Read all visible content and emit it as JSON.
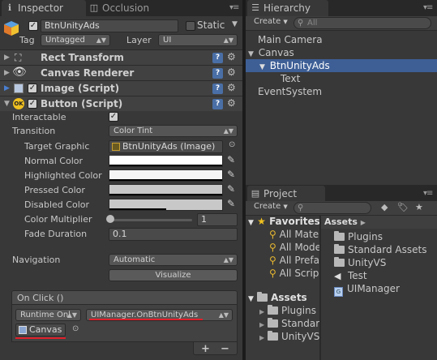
{
  "inspector": {
    "tabs": [
      {
        "label": "Inspector",
        "icon": "info-icon"
      },
      {
        "label": "Occlusion",
        "icon": "occlusion-icon"
      }
    ],
    "object": {
      "name": "BtnUnityAds",
      "active": true,
      "static_label": "Static",
      "tag_label": "Tag",
      "tag_value": "Untagged",
      "layer_label": "Layer",
      "layer_value": "UI"
    },
    "components": [
      {
        "title": "Rect Transform",
        "icon": "rect-transform-icon"
      },
      {
        "title": "Canvas Renderer",
        "icon": "eye-icon"
      },
      {
        "title": "Image (Script)",
        "icon": "script-icon",
        "enabled": true
      },
      {
        "title": "Button (Script)",
        "icon": "ok-icon",
        "enabled": true,
        "icon_text": "OK"
      }
    ],
    "button": {
      "interactable_label": "Interactable",
      "interactable": true,
      "transition_label": "Transition",
      "transition_value": "Color Tint",
      "target_graphic_label": "Target Graphic",
      "target_graphic_value": "BtnUnityAds (Image)",
      "normal_color_label": "Normal Color",
      "highlighted_color_label": "Highlighted Color",
      "pressed_color_label": "Pressed Color",
      "disabled_color_label": "Disabled Color",
      "color_multiplier_label": "Color Multiplier",
      "color_multiplier_value": "1",
      "fade_duration_label": "Fade Duration",
      "fade_duration_value": "0.1",
      "navigation_label": "Navigation",
      "navigation_value": "Automatic",
      "visualize_label": "Visualize",
      "normal_color": "#ffffff",
      "highlighted_color": "#f5f5f5",
      "pressed_color": "#c8c8c8",
      "disabled_color": "#c8c8c8"
    },
    "onclick": {
      "header": "On Click ()",
      "runtime_value": "Runtime Onl",
      "function_value": "UIManager.OnBtnUnityAds",
      "object_value": "Canvas",
      "add_label": "+",
      "remove_label": "−"
    }
  },
  "hierarchy": {
    "tab_label": "Hierarchy",
    "create_label": "Create",
    "search_placeholder": "All",
    "items": [
      {
        "label": "Main Camera"
      },
      {
        "label": "Canvas"
      },
      {
        "label": "BtnUnityAds"
      },
      {
        "label": "Text"
      },
      {
        "label": "EventSystem"
      }
    ]
  },
  "project": {
    "tab_label": "Project",
    "create_label": "Create",
    "favorites": {
      "label": "Favorites",
      "items": [
        "All Mate",
        "All Mode",
        "All Prefa",
        "All Scrip"
      ]
    },
    "assets_tree": {
      "label": "Assets",
      "items": [
        "Plugins",
        "Standar",
        "UnityVS"
      ]
    },
    "breadcrumb": "Assets",
    "assets_list": [
      {
        "label": "Plugins",
        "icon": "folder-icon"
      },
      {
        "label": "Standard Assets",
        "icon": "folder-icon"
      },
      {
        "label": "UnityVS",
        "icon": "folder-icon"
      },
      {
        "label": "Test",
        "icon": "unity-scene-icon"
      },
      {
        "label": "UIManager",
        "icon": "csharp-script-icon"
      }
    ]
  },
  "colors": {
    "selection": "#3e5f96",
    "annotation_red": "#e0202a",
    "panel_bg": "#383838"
  }
}
